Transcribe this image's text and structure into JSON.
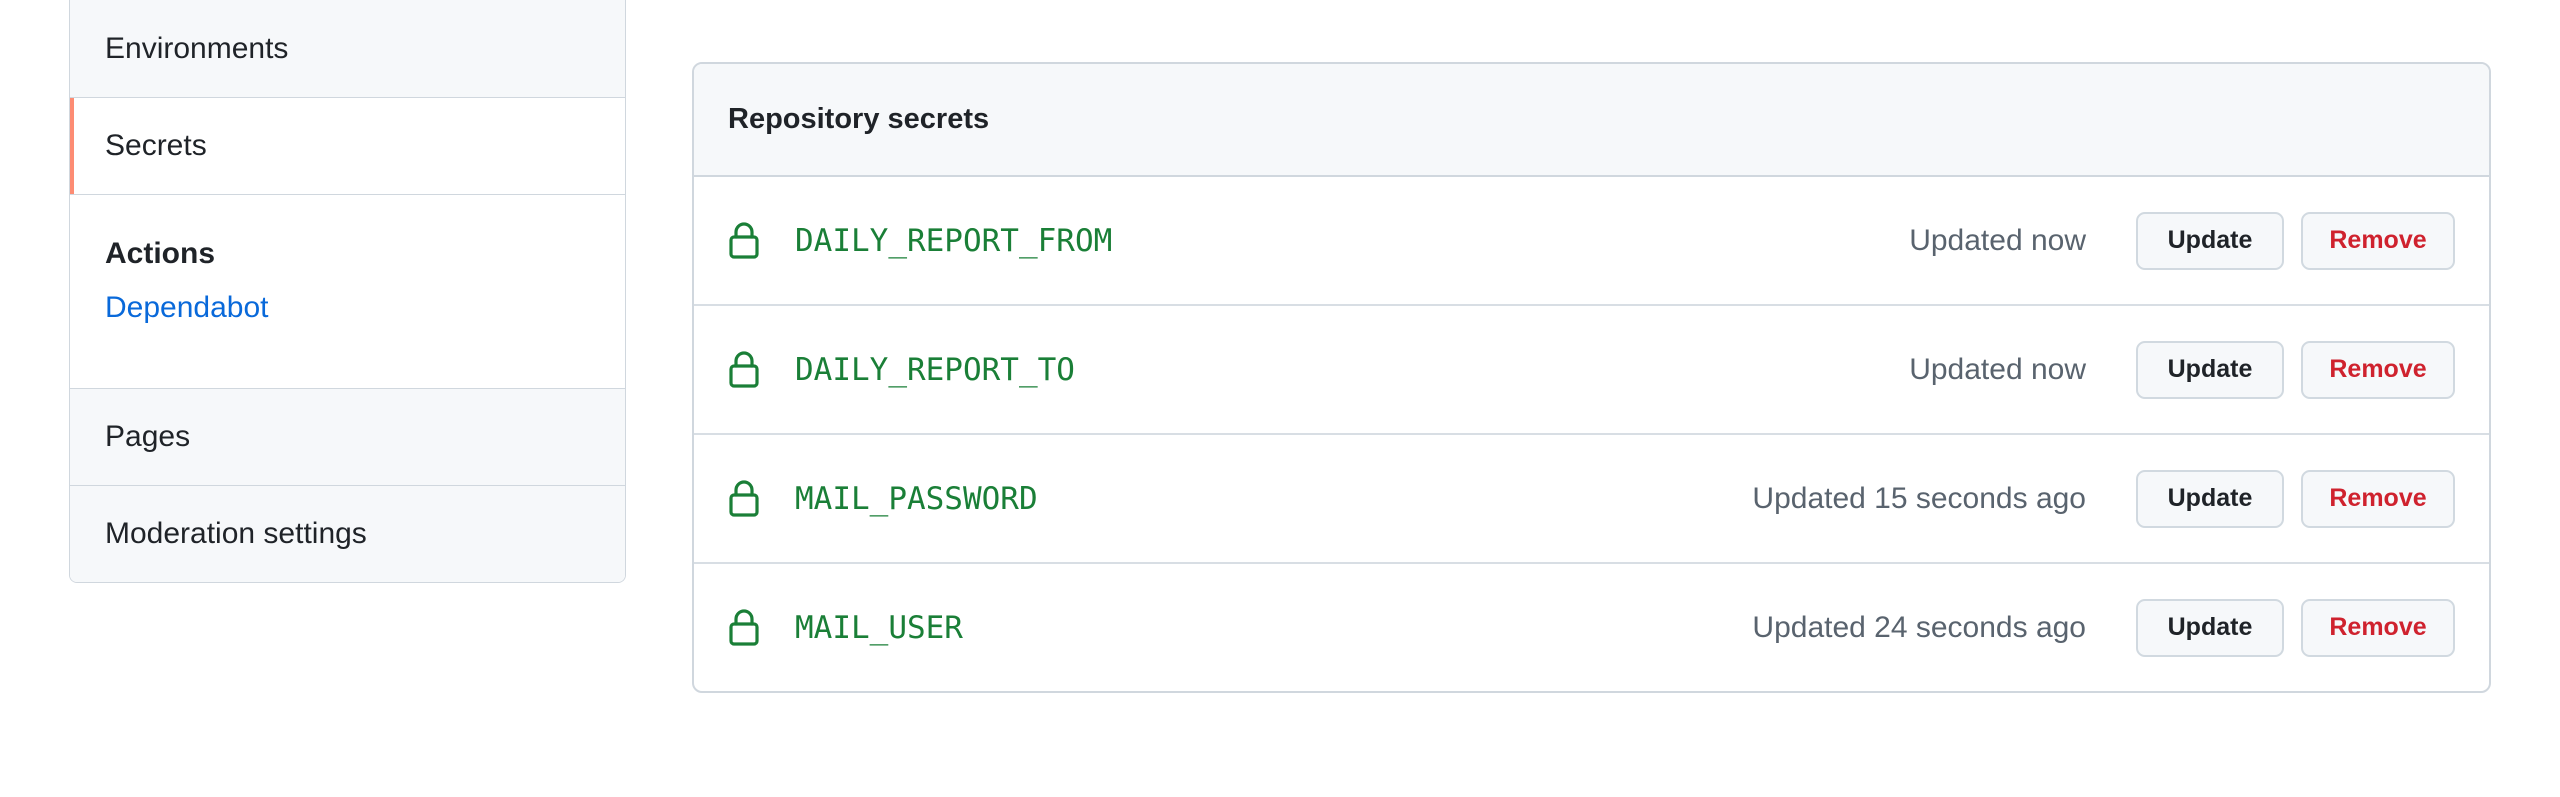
{
  "sidebar": {
    "items_top": [
      {
        "key": "environments",
        "label": "Environments",
        "active": false
      },
      {
        "key": "secrets",
        "label": "Secrets",
        "active": true
      }
    ],
    "group": {
      "heading": "Actions",
      "link": "Dependabot"
    },
    "items_bottom": [
      {
        "key": "pages",
        "label": "Pages"
      },
      {
        "key": "moderation",
        "label": "Moderation settings"
      }
    ]
  },
  "secrets_box": {
    "title": "Repository secrets",
    "rows": [
      {
        "name": "DAILY_REPORT_FROM",
        "updated": "Updated now",
        "update_label": "Update",
        "remove_label": "Remove"
      },
      {
        "name": "DAILY_REPORT_TO",
        "updated": "Updated now",
        "update_label": "Update",
        "remove_label": "Remove"
      },
      {
        "name": "MAIL_PASSWORD",
        "updated": "Updated 15 seconds ago",
        "update_label": "Update",
        "remove_label": "Remove"
      },
      {
        "name": "MAIL_USER",
        "updated": "Updated 24 seconds ago",
        "update_label": "Update",
        "remove_label": "Remove"
      }
    ]
  },
  "icons": {
    "row_icon": "lock-icon"
  },
  "colors": {
    "active_indicator": "#fd8c73",
    "secret_name": "#1a7f37",
    "link": "#0969da",
    "remove": "#cf222e"
  }
}
